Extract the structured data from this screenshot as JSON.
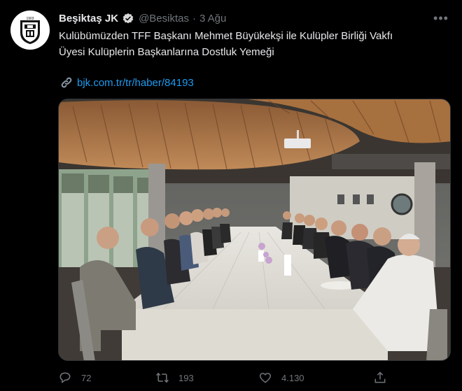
{
  "author": {
    "name": "Beşiktaş JK",
    "handle": "@Besiktas",
    "separator": "·",
    "date": "3 Ağu",
    "avatar_icon": "besiktas-crest-icon",
    "verified_icon": "verified-badge-icon"
  },
  "more_label": "•••",
  "tweet": {
    "text_line1": "Kulübümüzden TFF Başkanı Mehmet Büyükekşi ile Kulüpler Birliği Vakfı",
    "text_line2": "Üyesi Kulüplerin Başkanlarına Dostluk Yemeği",
    "link_icon": "link-icon",
    "link": "bjk.com.tr/tr/haber/84193"
  },
  "actions": {
    "reply_count": "72",
    "retweet_count": "193",
    "like_count": "4.130",
    "reply_icon": "reply-icon",
    "retweet_icon": "retweet-icon",
    "like_icon": "heart-icon",
    "share_icon": "share-icon"
  },
  "colors": {
    "background": "#000000",
    "text": "#e7e9ea",
    "muted": "#71767b",
    "link": "#1d9bf0",
    "verified": "#d9d9d9"
  }
}
